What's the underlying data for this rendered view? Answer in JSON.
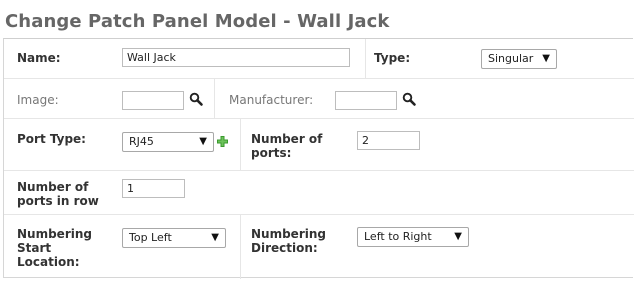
{
  "page_title": "Change Patch Panel Model - Wall Jack",
  "form": {
    "name_label": "Name:",
    "name_value": "Wall Jack",
    "type_label": "Type:",
    "type_value": "Singular",
    "image_label": "Image:",
    "image_value": "",
    "manufacturer_label": "Manufacturer:",
    "manufacturer_value": "",
    "port_type_label": "Port Type:",
    "port_type_value": "RJ45",
    "number_of_ports_label_1": "Number of",
    "number_of_ports_label_2": "ports:",
    "number_of_ports_value": "2",
    "ports_in_row_label_1": "Number of",
    "ports_in_row_label_2": "ports in row",
    "ports_in_row_value": "1",
    "numbering_start_label_1": "Numbering",
    "numbering_start_label_2": "Start",
    "numbering_start_label_3": "Location:",
    "numbering_start_value": "Top Left",
    "numbering_direction_label_1": "Numbering",
    "numbering_direction_label_2": "Direction:",
    "numbering_direction_value": "Left to Right"
  },
  "icons": {
    "image_search": "search-icon",
    "manufacturer_search": "search-icon",
    "add_port_type": "plus-icon",
    "dropdown_arrow": "▼"
  },
  "colors": {
    "add_icon": "#3a9a2e",
    "title": "#666666"
  }
}
